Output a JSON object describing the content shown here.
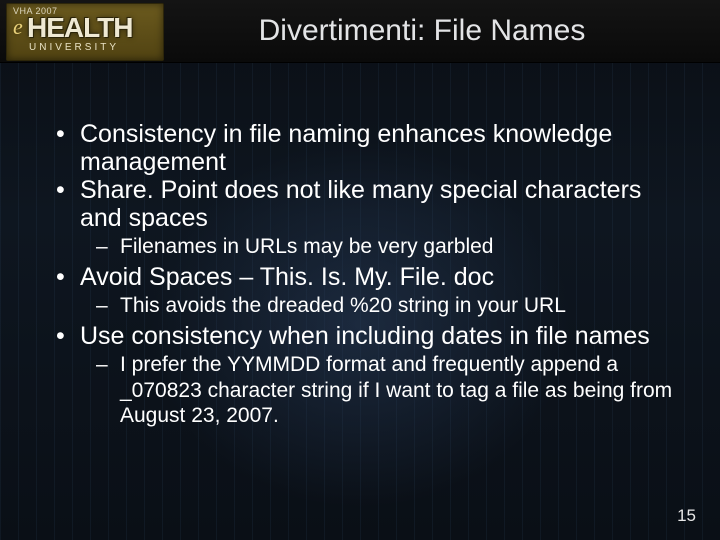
{
  "header": {
    "logo_vha": "VHA 2007",
    "logo_e": "e",
    "logo_health": "HEALTH",
    "logo_univ": "UNIVERSITY"
  },
  "title": "Divertimenti: File Names",
  "bullets": [
    {
      "text": "Consistency in file naming enhances knowledge management",
      "sub": []
    },
    {
      "text": "Share. Point does not like many special characters and spaces",
      "sub": [
        "Filenames in URLs may be very garbled"
      ]
    },
    {
      "text": "Avoid Spaces – This. Is. My. File. doc",
      "sub": [
        "This avoids the dreaded %20 string in your URL"
      ]
    },
    {
      "text": "Use consistency when including dates in file names",
      "sub": [
        "I prefer the YYMMDD format and frequently append a _070823 character string if I want to tag a file as being from August 23, 2007."
      ]
    }
  ],
  "page_number": "15"
}
